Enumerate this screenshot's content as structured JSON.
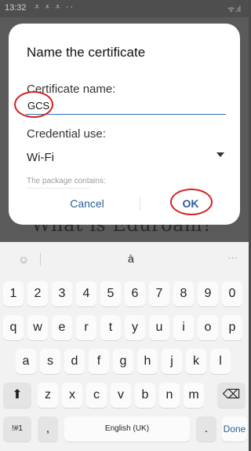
{
  "status_bar": {
    "time": "13:32",
    "notif_icons": "⩡ ⩡ ⩡ ··",
    "signal_text": "ᯤ.ıl"
  },
  "background_text": "What is Eduroam?",
  "dialog": {
    "title": "Name the certificate",
    "cert_label": "Certificate name:",
    "cert_value": "GCS",
    "cred_label": "Credential use:",
    "cred_value": "Wi-Fi",
    "note": "The package contains:",
    "cancel_label": "Cancel",
    "ok_label": "OK"
  },
  "keyboard": {
    "suggestion": "à",
    "emoji_glyph": "☺",
    "more": "···",
    "row_numbers": [
      "1",
      "2",
      "3",
      "4",
      "5",
      "6",
      "7",
      "8",
      "9",
      "0"
    ],
    "row_q": [
      "q",
      "w",
      "e",
      "r",
      "t",
      "y",
      "u",
      "i",
      "o",
      "p"
    ],
    "row_a": [
      "a",
      "s",
      "d",
      "f",
      "g",
      "h",
      "j",
      "k",
      "l"
    ],
    "row_z": [
      "z",
      "x",
      "c",
      "v",
      "b",
      "n",
      "m"
    ],
    "shift": "⬆",
    "backspace": "⌫",
    "symbols": "!#1",
    "comma": ",",
    "space": "English (UK)",
    "period": ".",
    "done": "Done"
  },
  "annotation_color": "#d42020"
}
